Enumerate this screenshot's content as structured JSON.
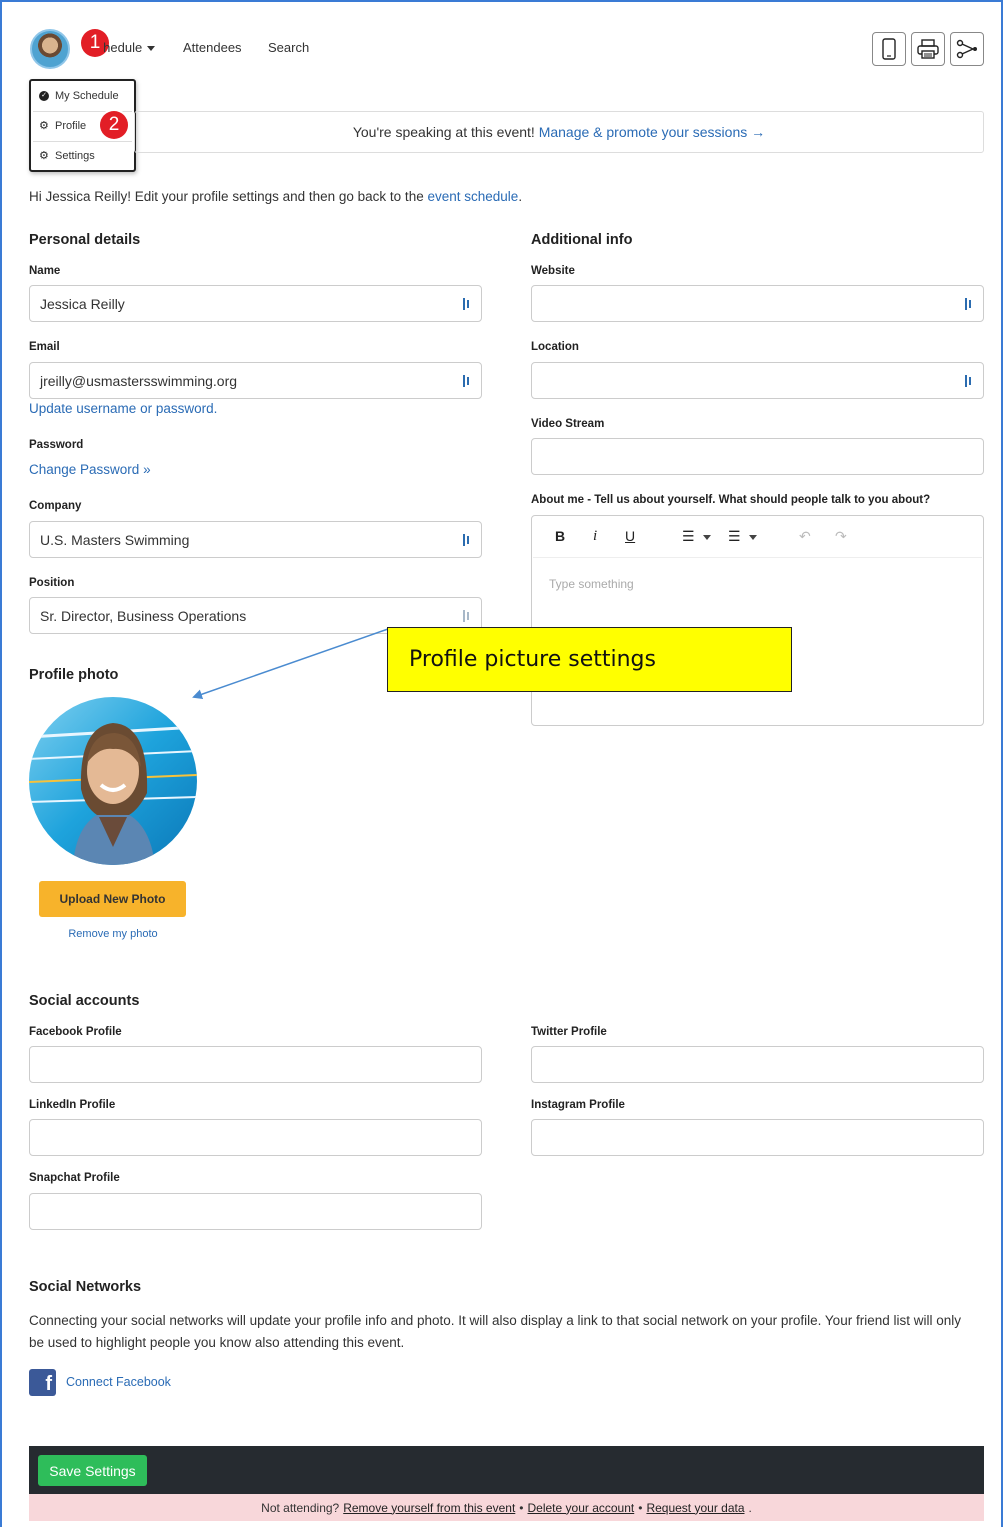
{
  "nav": {
    "schedule_label": "Schedule",
    "attendees_label": "Attendees",
    "search_label": "Search",
    "step1": "1",
    "step2": "2"
  },
  "dropdown": {
    "items": [
      {
        "label": "My Schedule",
        "icon": "check-circle-icon"
      },
      {
        "label": "Profile",
        "icon": "gear-icon"
      },
      {
        "label": "Settings",
        "icon": "gear-icon"
      }
    ]
  },
  "banner": {
    "text": "You're speaking at this event!",
    "link": "Manage & promote your sessions →"
  },
  "intro": {
    "text_before": "Hi Jessica Reilly! Edit your profile settings and then go back to the",
    "link": "event schedule",
    "text_after": "."
  },
  "personal": {
    "title": "Personal details",
    "name_label": "Name",
    "name_value": "Jessica Reilly",
    "email_label": "Email",
    "email_value": "jreilly@usmastersswimming.org",
    "update_link": "Update username or password.",
    "password_label": "Password",
    "change_password_link": "Change Password »",
    "company_label": "Company",
    "company_value": "U.S. Masters Swimming",
    "position_label": "Position",
    "position_value": "Sr. Director, Business Operations"
  },
  "additional": {
    "title": "Additional info",
    "website_label": "Website",
    "location_label": "Location",
    "video_label": "Video Stream",
    "about_label": "About me - Tell us about yourself. What should people talk to you about?",
    "about_placeholder": "Type something"
  },
  "editor_toolbar": {
    "bold": "B",
    "italic": "i",
    "underline": "U",
    "ordered_list": "☰",
    "bullet_list": "☰",
    "undo": "↶",
    "redo": "↷"
  },
  "callout": {
    "text": "Profile picture settings"
  },
  "photo": {
    "title": "Profile photo",
    "upload_label": "Upload New Photo",
    "remove_label": "Remove my photo"
  },
  "social_accounts": {
    "title": "Social accounts",
    "facebook_label": "Facebook Profile",
    "twitter_label": "Twitter Profile",
    "linkedin_label": "LinkedIn Profile",
    "instagram_label": "Instagram Profile",
    "snapchat_label": "Snapchat Profile"
  },
  "social_networks": {
    "title": "Social Networks",
    "description": "Connecting your social networks will update your profile info and photo. It will also display a link to that social network on your profile. Your friend list will only be used to highlight people you know also attending this event.",
    "connect_facebook": "Connect Facebook"
  },
  "footer": {
    "save_label": "Save Settings",
    "not_attending": "Not attending?",
    "remove_link": "Remove yourself from this event",
    "sep": "•",
    "delete_link": "Delete your account",
    "request_link": "Request your data",
    "end": "."
  },
  "colors": {
    "accent_link": "#2a6bb5",
    "upload_button": "#f7b32b",
    "save_button": "#2ebd5a",
    "footer_bar": "#262b30",
    "notice_bg": "#f8d7da",
    "callout_bg": "#ffff00",
    "badge_red": "#e21e26"
  }
}
